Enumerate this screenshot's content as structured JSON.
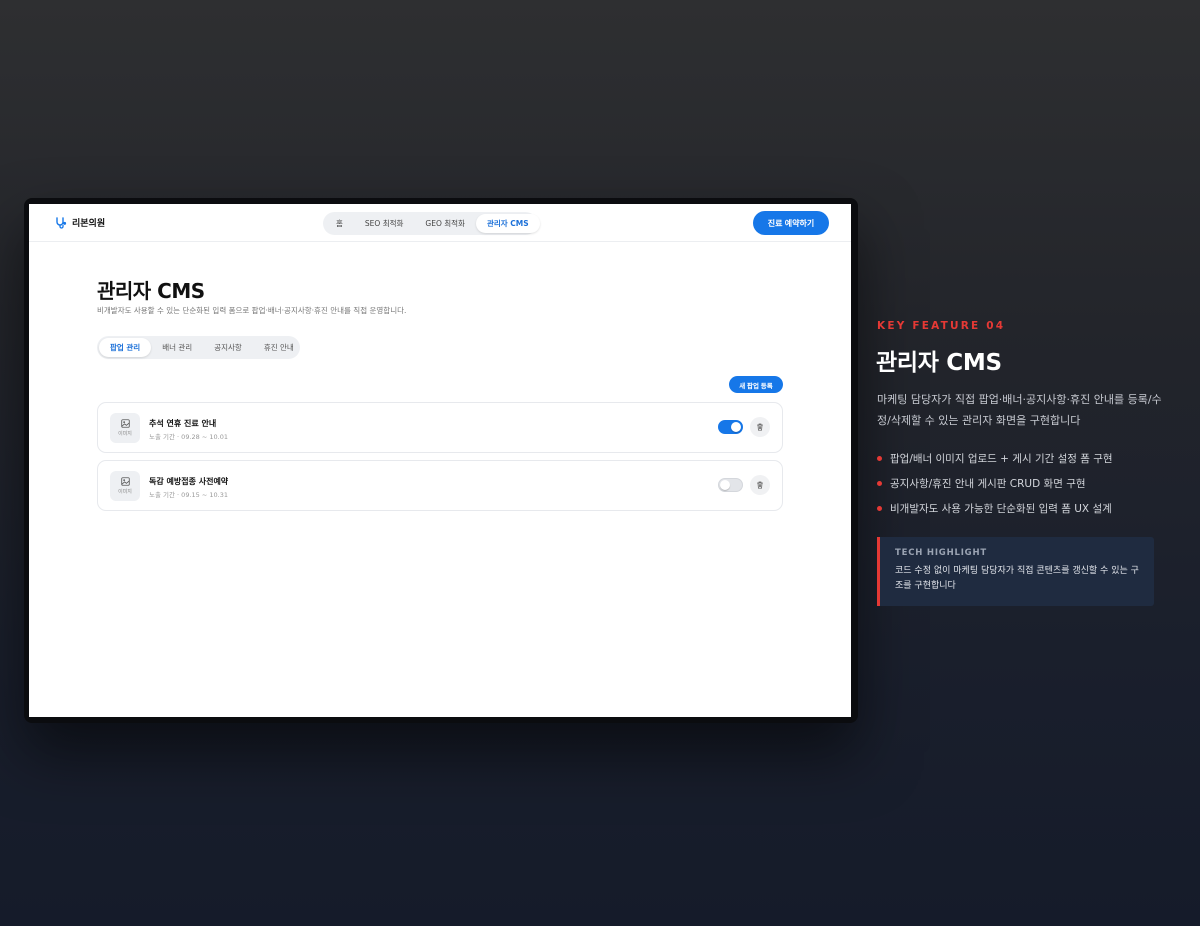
{
  "app": {
    "brand_name": "리본의원",
    "nav": {
      "items": [
        {
          "label": "홈"
        },
        {
          "label": "SEO 최적화"
        },
        {
          "label": "GEO 최적화"
        },
        {
          "label": "관리자 CMS"
        }
      ],
      "active": "관리자 CMS"
    },
    "cta_label": "진료 예약하기",
    "accent_color": "#1677e8"
  },
  "page": {
    "title": "관리자 CMS",
    "subtitle": "비개발자도 사용할 수 있는 단순화된 입력 폼으로 팝업·배너·공지사항·휴진 안내를 직접 운영합니다.",
    "tabs": [
      {
        "label": "팝업 관리"
      },
      {
        "label": "배너 관리"
      },
      {
        "label": "공지사항"
      },
      {
        "label": "휴진 안내"
      }
    ],
    "active_tab": "팝업 관리",
    "new_button_label": "새 팝업 등록",
    "popups": [
      {
        "thumb_label": "이미지",
        "title": "추석 연휴 진료 안내",
        "period": "노출 기간 · 09.28 ~ 10.01",
        "enabled": true
      },
      {
        "thumb_label": "이미지",
        "title": "독감 예방접종 사전예약",
        "period": "노출 기간 · 09.15 ~ 10.31",
        "enabled": false
      }
    ]
  },
  "feature": {
    "kicker": "KEY FEATURE 04",
    "title": "관리자 CMS",
    "description": "마케팅 담당자가 직접 팝업·배너·공지사항·휴진 안내를 등록/수정/삭제할 수 있는 관리자 화면을 구현합니다",
    "bullets": [
      "팝업/배너 이미지 업로드 + 게시 기간 설정 폼 구현",
      "공지사항/휴진 안내 게시판 CRUD 화면 구현",
      "비개발자도 사용 가능한 단순화된 입력 폼 UX 설계"
    ],
    "highlight": {
      "label": "TECH HIGHLIGHT",
      "text": "코드 수정 없이 마케팅 담당자가 직접 콘텐츠를 갱신할 수 있는 구조를 구현합니다"
    },
    "accent_color": "#e53935"
  }
}
